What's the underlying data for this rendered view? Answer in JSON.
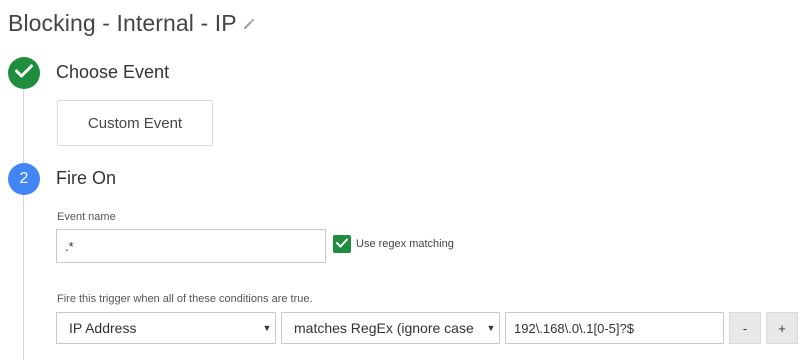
{
  "trigger": {
    "title": "Blocking - Internal - IP"
  },
  "steps": [
    {
      "number": "",
      "title": "Choose Event",
      "status": "complete",
      "color": "#1e8e3e"
    },
    {
      "number": "2",
      "title": "Fire On",
      "status": "active",
      "color": "#4285f4"
    }
  ],
  "choose_event": {
    "selected_event": "Custom Event"
  },
  "fire_on": {
    "event_name_label": "Event name",
    "event_name_value": ".*",
    "use_regex_label": "Use regex matching",
    "use_regex_checked": true,
    "conditions_label": "Fire this trigger when all of these conditions are true.",
    "condition": {
      "variable": "IP Address",
      "operator": "matches RegEx (ignore case",
      "value": "192\\.168\\.0\\.1[0-5]?$"
    },
    "remove_label": "-",
    "add_label": "+"
  },
  "icons": {
    "edit": "pencil-icon",
    "check": "checkmark-icon",
    "dropdown": "chevron-down-icon"
  }
}
